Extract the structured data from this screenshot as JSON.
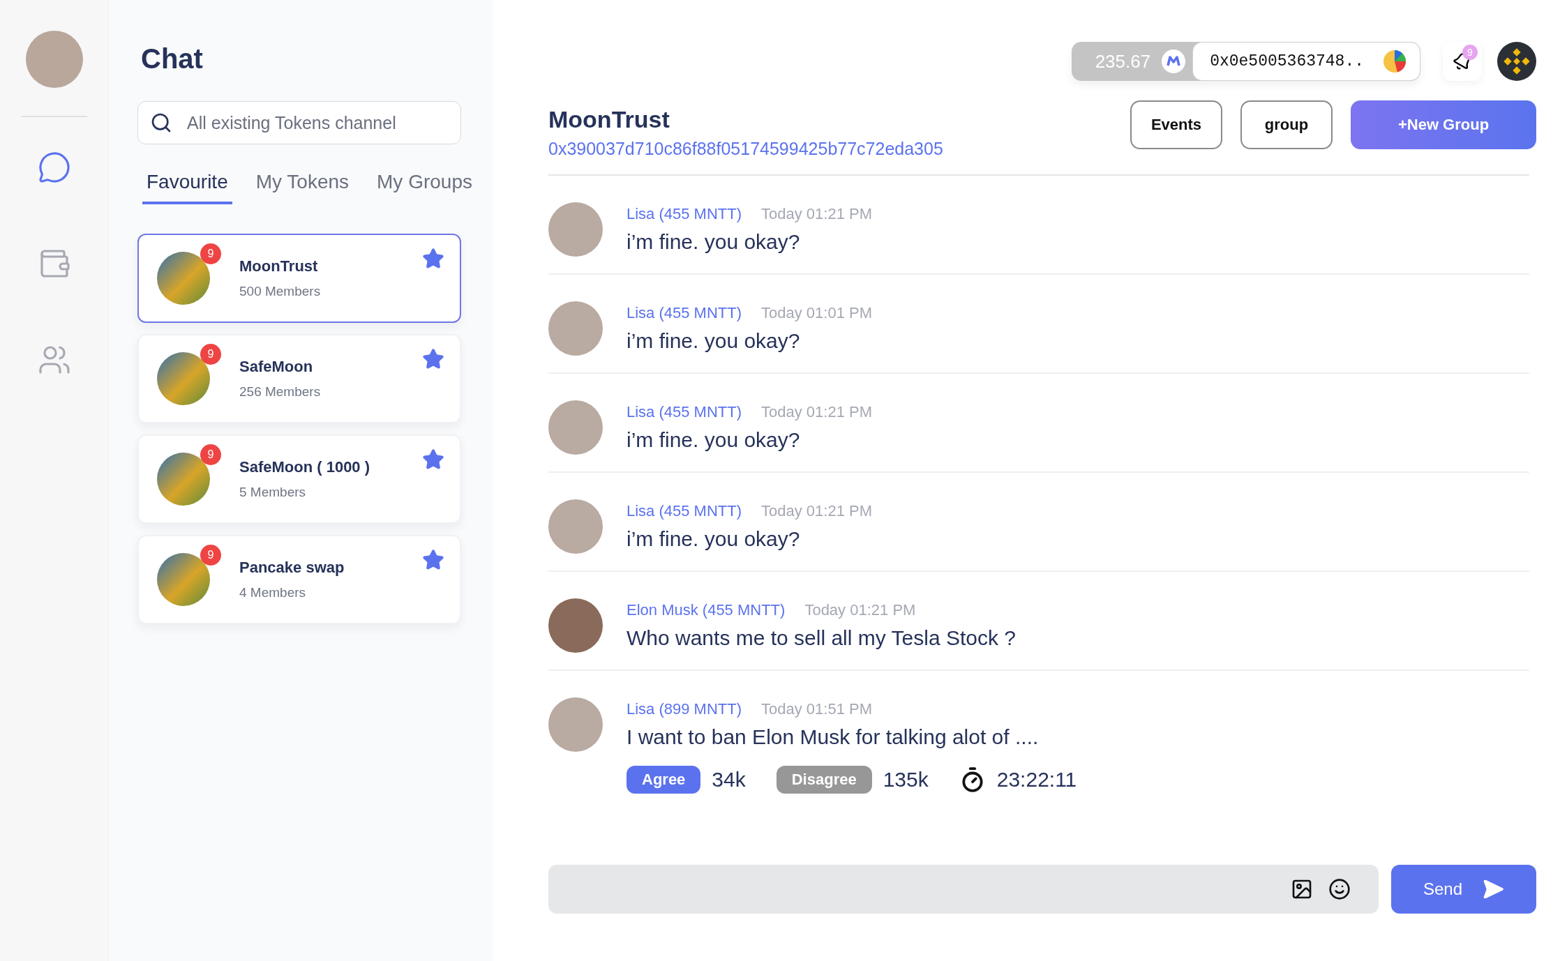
{
  "nav": [
    {
      "kind": "chat",
      "selected": true
    },
    {
      "kind": "wallet",
      "selected": false
    },
    {
      "kind": "people",
      "selected": false
    }
  ],
  "panel": {
    "title": "Chat",
    "search": {
      "placeholder": "All existing Tokens channel"
    },
    "tabs": [
      {
        "label": "Favourite",
        "selected": true
      },
      {
        "label": "My Tokens",
        "selected": false
      },
      {
        "label": "My Groups",
        "selected": false
      }
    ],
    "channels": [
      {
        "name": "MoonTrust",
        "members": "500 Members",
        "badge": "9",
        "starred": true,
        "selected": true
      },
      {
        "name": "SafeMoon",
        "members": "256 Members",
        "badge": "9",
        "starred": true,
        "selected": false
      },
      {
        "name": "SafeMoon ( 1000 )",
        "members": "5 Members",
        "badge": "9",
        "starred": true,
        "selected": false
      },
      {
        "name": "Pancake swap",
        "members": "4 Members",
        "badge": "9",
        "starred": true,
        "selected": false
      }
    ]
  },
  "header": {
    "balance": "235.67",
    "wallet": "0x0e5005363748..",
    "notifications": "9"
  },
  "room": {
    "name": "MoonTrust",
    "address": "0x390037d710c86f88f05174599425b77c72eda305",
    "actions": [
      "Events",
      "group"
    ],
    "primary_action": "+New Group"
  },
  "messages": [
    {
      "kind": "text",
      "sender": "Lisa (455 MNTT)",
      "time": "Today 01:21 PM",
      "text": "i’m fine. you okay?"
    },
    {
      "kind": "text",
      "sender": "Lisa (455 MNTT)",
      "time": "Today 01:01 PM",
      "text": "i’m fine. you okay?"
    },
    {
      "kind": "text",
      "sender": "Lisa (455 MNTT)",
      "time": "Today 01:21 PM",
      "text": "i’m fine. you okay?"
    },
    {
      "kind": "text",
      "sender": "Lisa (455 MNTT)",
      "time": "Today 01:21 PM",
      "text": "i’m fine. you okay?"
    },
    {
      "kind": "text",
      "sender": "Elon Musk (455 MNTT)",
      "time": "Today 01:21 PM",
      "text": "Who wants me to sell all my Tesla Stock ?"
    },
    {
      "kind": "poll",
      "sender": "Lisa (899 MNTT)",
      "time": "Today 01:51 PM",
      "text": "I want to ban Elon Musk for talking alot of ....",
      "agree": "Agree",
      "agree_count": "34k",
      "disagree": "Disagree",
      "disagree_count": "135k",
      "timer": "23:22:11"
    }
  ],
  "composer": {
    "send": "Send"
  }
}
